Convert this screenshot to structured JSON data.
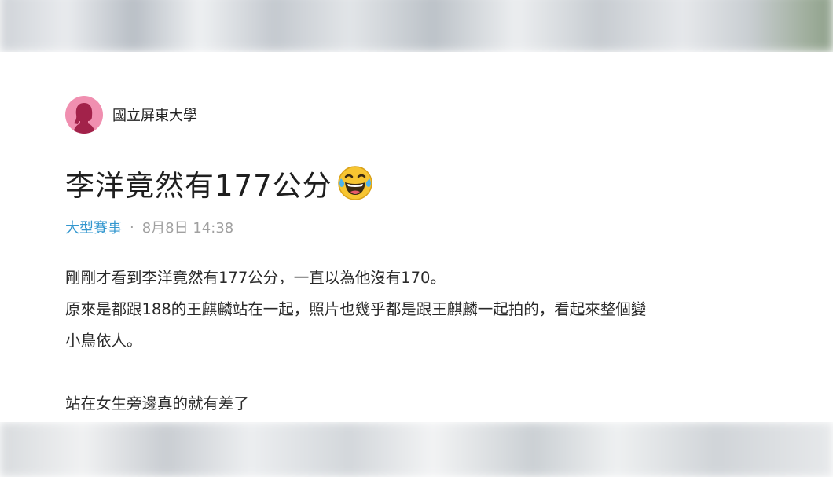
{
  "author": {
    "name": "國立屏東大學",
    "avatar_icon": "female-avatar-icon",
    "avatar_color": "#f08fb0"
  },
  "post": {
    "title": "李洋竟然有177公分",
    "title_emoji": "tears-of-joy-emoji-icon",
    "category": "大型賽事",
    "separator": "·",
    "date": "8月8日 14:38",
    "lines": [
      "剛剛才看到李洋竟然有177公分，一直以為他沒有170。",
      "原來是都跟188的王麒麟站在一起，照片也幾乎都是跟王麒麟一起拍的，看起來整個變",
      "小鳥依人。",
      "站在女生旁邊真的就有差了"
    ]
  },
  "colors": {
    "category": "#3397cf",
    "meta": "#a0a0a0",
    "text": "#2a2a2a"
  }
}
